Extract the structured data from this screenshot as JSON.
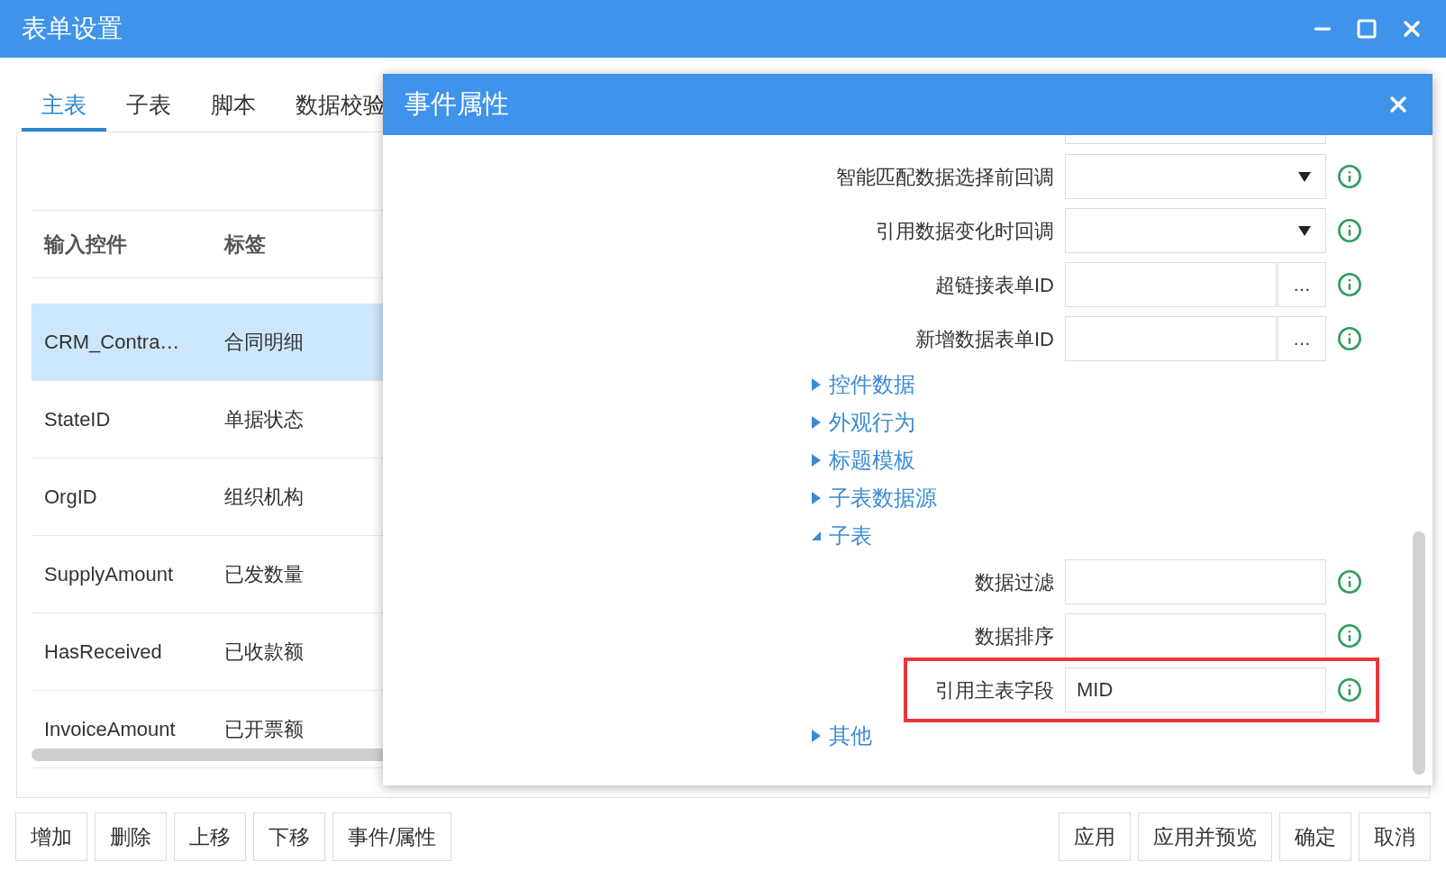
{
  "window": {
    "title": "表单设置"
  },
  "tabs": [
    {
      "label": "主表",
      "selected": true
    },
    {
      "label": "子表",
      "selected": false
    },
    {
      "label": "脚本",
      "selected": false
    },
    {
      "label": "数据校验",
      "selected": false
    }
  ],
  "table": {
    "columns": [
      "输入控件",
      "标签"
    ],
    "rows": [
      {
        "cells": [
          "CRM_Contra…",
          "合同明细"
        ],
        "selected": true
      },
      {
        "cells": [
          "StateID",
          "单据状态"
        ],
        "selected": false
      },
      {
        "cells": [
          "OrgID",
          "组织机构"
        ],
        "selected": false
      },
      {
        "cells": [
          "SupplyAmount",
          "已发数量"
        ],
        "selected": false
      },
      {
        "cells": [
          "HasReceived",
          "已收款额"
        ],
        "selected": false
      },
      {
        "cells": [
          "InvoiceAmount",
          "已开票额"
        ],
        "selected": false
      }
    ]
  },
  "buttons_left": [
    "增加",
    "删除",
    "上移",
    "下移",
    "事件/属性"
  ],
  "buttons_right": [
    "应用",
    "应用并预览",
    "确定",
    "取消"
  ],
  "dialog": {
    "title": "事件属性",
    "items": [
      {
        "kind": "cut"
      },
      {
        "kind": "select",
        "label": "智能匹配数据选择前回调"
      },
      {
        "kind": "select",
        "label": "引用数据变化时回调"
      },
      {
        "kind": "picker",
        "label": "超链接表单ID",
        "button_text": "…"
      },
      {
        "kind": "picker",
        "label": "新增数据表单ID",
        "button_text": "…"
      },
      {
        "kind": "section",
        "label": "控件数据",
        "expanded": false
      },
      {
        "kind": "section",
        "label": "外观行为",
        "expanded": false
      },
      {
        "kind": "section",
        "label": "标题模板",
        "expanded": false
      },
      {
        "kind": "section",
        "label": "子表数据源",
        "expanded": false
      },
      {
        "kind": "section",
        "label": "子表",
        "expanded": true,
        "children": [
          {
            "kind": "text",
            "label": "数据过滤",
            "highlighted": false
          },
          {
            "kind": "text",
            "label": "数据排序",
            "highlighted": false
          },
          {
            "kind": "text",
            "label": "引用主表字段",
            "value": "MID",
            "highlighted": true
          }
        ]
      },
      {
        "kind": "section",
        "label": "其他",
        "expanded": false
      }
    ]
  }
}
